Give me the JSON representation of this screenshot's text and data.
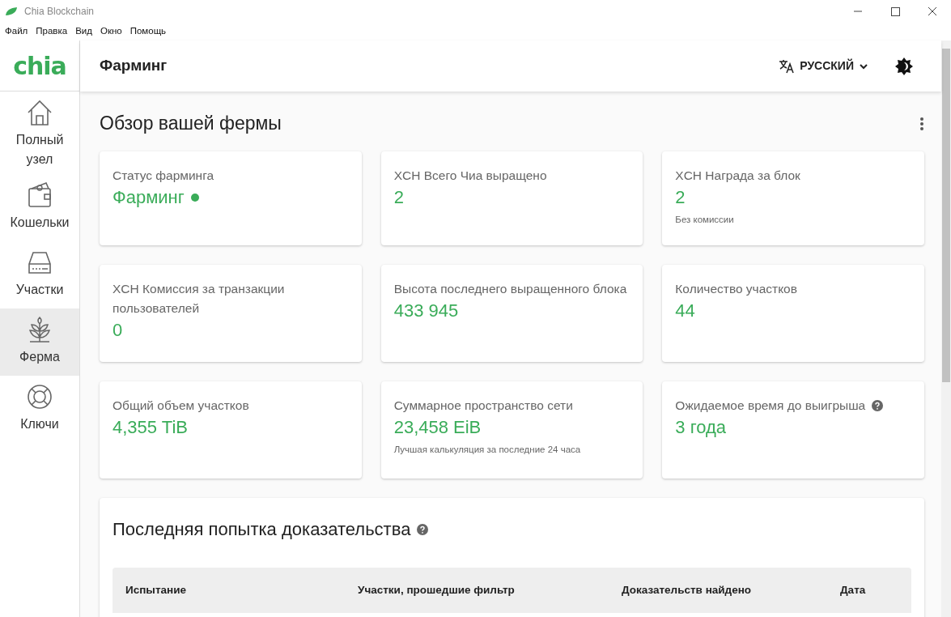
{
  "window": {
    "title": "Chia Blockchain"
  },
  "menu": [
    "Файл",
    "Правка",
    "Вид",
    "Окно",
    "Помощь"
  ],
  "sidebar": {
    "logo": "chia",
    "items": [
      {
        "kind": "home",
        "label": "Полный узел",
        "selected": false
      },
      {
        "kind": "wallet",
        "label": "Кошельки",
        "selected": false
      },
      {
        "kind": "plots",
        "label": "Участки",
        "selected": false
      },
      {
        "kind": "farm",
        "label": "Ферма",
        "selected": true
      },
      {
        "kind": "keys",
        "label": "Ключи",
        "selected": false
      }
    ]
  },
  "header": {
    "title": "Фарминг",
    "language": "РУССКИЙ"
  },
  "overview": {
    "title": "Обзор вашей фермы",
    "cards": [
      {
        "label": "Статус фарминга",
        "value": "Фарминг",
        "status_dot": true
      },
      {
        "label": "XCH Всего Чиа выращено",
        "value": "2"
      },
      {
        "label": "XCH Награда за блок",
        "value": "2",
        "note": "Без комиссии"
      },
      {
        "label": "XCH Комиссия за транзакции пользователей",
        "value": "0"
      },
      {
        "label": "Высота последнего выращенного блока",
        "value": "433 945"
      },
      {
        "label": "Количество участков",
        "value": "44"
      },
      {
        "label": "Общий объем участков",
        "value": "4,355 TiB"
      },
      {
        "label": "Суммарное пространство сети",
        "value": "23,458 EiB",
        "note": "Лучшая калькуляция за последние 24 часа"
      },
      {
        "label": "Ожидаемое время до выигрыша",
        "value": "3 года",
        "help": true
      }
    ]
  },
  "proofs": {
    "title": "Последняя попытка доказательства",
    "help": true,
    "columns": [
      "Испытание",
      "Участки, прошедшие фильтр",
      "Доказательств найдено",
      "Дата"
    ]
  }
}
